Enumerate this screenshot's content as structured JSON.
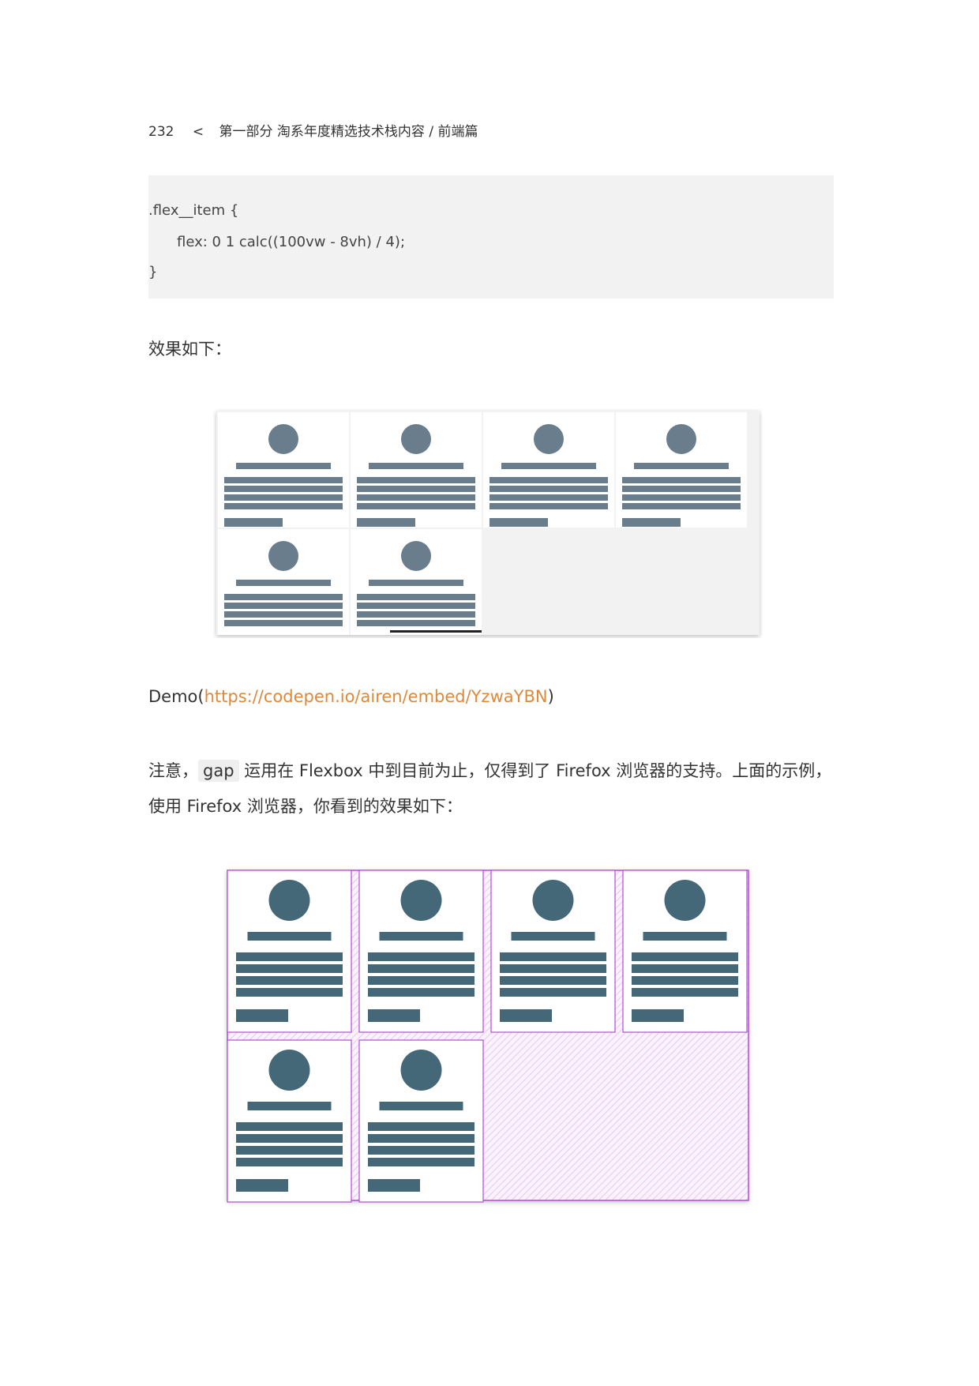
{
  "header": {
    "page_number": "232",
    "separator": "<",
    "section": "第一部分 淘系年度精选技术栈内容 / 前端篇"
  },
  "code": {
    "lines": [
      ".flex__item {",
      "flex: 0 1 calc((100vw - 8vh) / 4);",
      "}"
    ]
  },
  "paragraphs": {
    "result_intro": "效果如下：",
    "demo_prefix": "Demo(",
    "demo_url": "https://codepen.io/airen/embed/YzwaYBN",
    "demo_suffix": ")",
    "note_line1_prefix": "注意，",
    "note_code": "gap",
    "note_line1_suffix": " 运用在 Flexbox 中到目前为止，仅得到了 Firefox 浏览器的支持。上面的示例，",
    "note_line2": "使用 Firefox 浏览器，你看到的效果如下："
  },
  "colors": {
    "code_bg": "#f2f2f2",
    "link": "#e0883a",
    "card_gray": "#6a7d8c",
    "card_dark": "#456878",
    "grid_purple": "#b04cd8"
  },
  "figures": {
    "figure1": {
      "cards": 6,
      "columns": 4
    },
    "figure2": {
      "cards": 6,
      "columns": 4
    }
  }
}
